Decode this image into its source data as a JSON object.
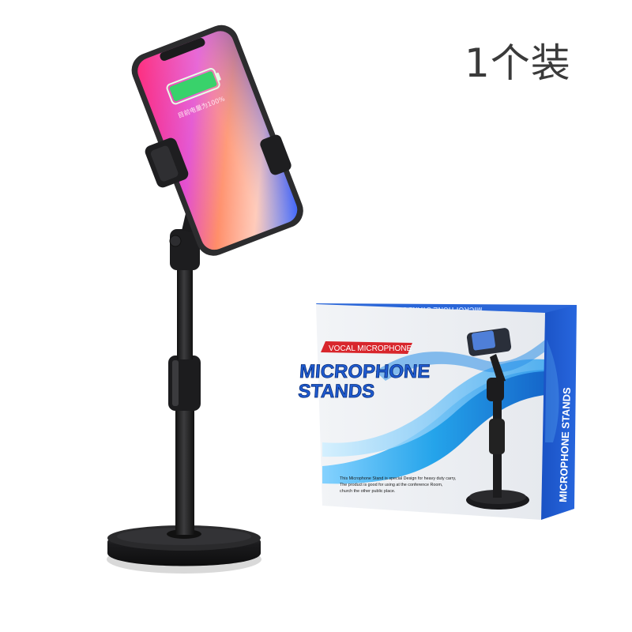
{
  "quantity_label": "1个装",
  "phone": {
    "battery_fill": 1.0,
    "screen_caption": "目前电量为100%"
  },
  "box": {
    "ribbon_text": "VOCAL MICROPHONE",
    "title_line1": "MICROPHONE",
    "title_line2": "STANDS",
    "side_text": "MICROPHONE STANDS",
    "top_text": "MICROPHONE STANDS",
    "description_line1": "This Microphone Stand is special Design for heavy duty carry,",
    "description_line2": "The product is good for using at the conference Room,",
    "description_line3": "church the other public place."
  },
  "colors": {
    "stand_black": "#1b1b1d",
    "box_blue": "#1f5bd1",
    "ribbon_red": "#d8262c",
    "wave_blue": "#0f8ee0",
    "background": "#ffffff"
  }
}
